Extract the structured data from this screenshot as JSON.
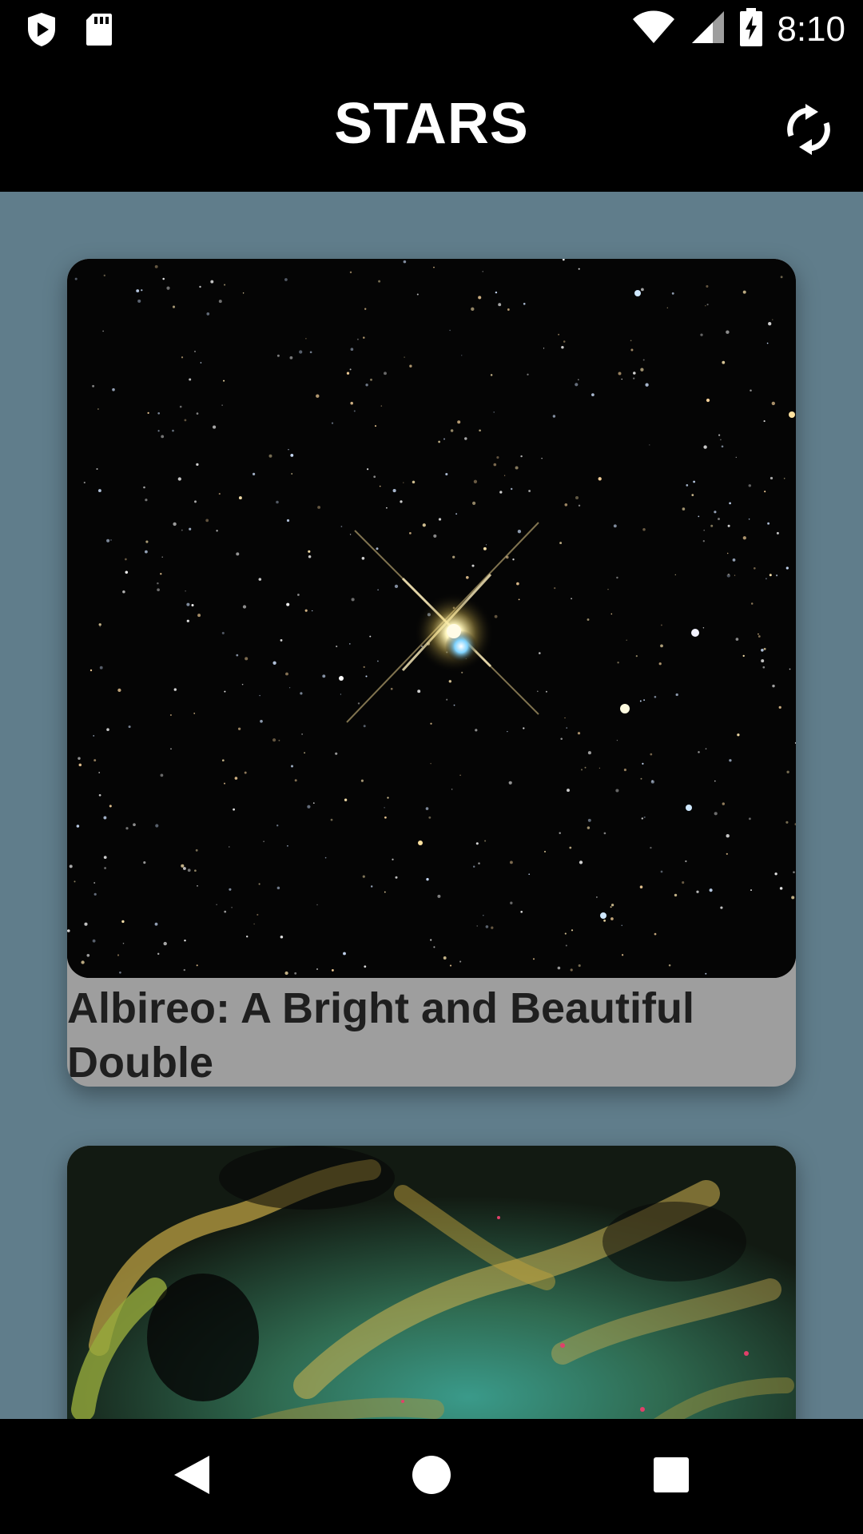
{
  "status_bar": {
    "time": "8:10",
    "left_icons": [
      "play-shield-icon",
      "sd-card-icon"
    ],
    "right_icons": [
      "wifi-icon",
      "cell-signal-icon",
      "battery-charging-icon"
    ]
  },
  "toolbar": {
    "title": "STARS",
    "refresh_icon": "refresh-icon"
  },
  "cards": [
    {
      "title": "Albireo: A Bright and Beautiful Double",
      "image": "starfield-image"
    },
    {
      "title": "",
      "image": "nebula-image"
    }
  ],
  "nav_bar": {
    "icons": [
      "back-icon",
      "home-icon",
      "recents-icon"
    ]
  },
  "colors": {
    "content_background": "#607d8b",
    "card_background": "#9e9e9e",
    "bars": "#000000"
  }
}
